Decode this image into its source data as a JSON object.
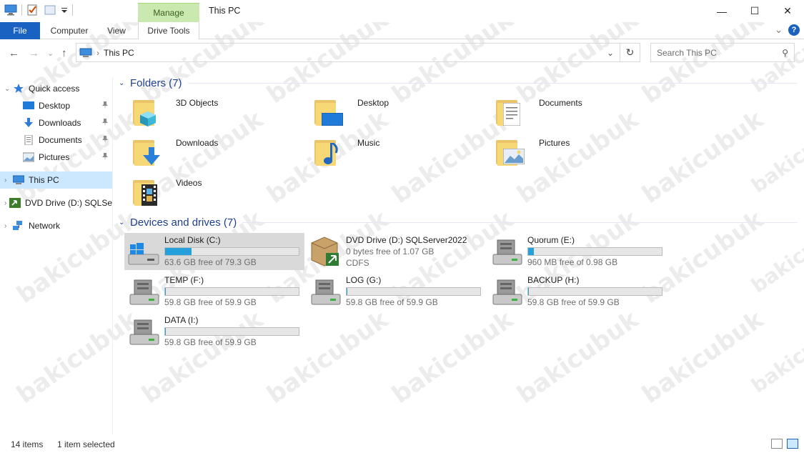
{
  "window": {
    "title": "This PC",
    "manage_tab": "Manage",
    "minimize": "—",
    "maximize": "☐",
    "close": "✕"
  },
  "ribbon": {
    "tabs": [
      "File",
      "Computer",
      "View",
      "Drive Tools"
    ],
    "collapse_glyph": "⌄",
    "help_glyph": "?"
  },
  "nav": {
    "back": "←",
    "forward": "→",
    "recent": "⌄",
    "up": "↑",
    "sep": "›",
    "address": "This PC",
    "dropdown": "⌄",
    "refresh": "↻",
    "search_placeholder": "Search This PC",
    "search_icon": "⚲"
  },
  "sidebar": {
    "items": [
      {
        "label": "Quick access",
        "icon": "star-icon",
        "chevron": "⌄"
      },
      {
        "label": "Desktop",
        "icon": "desktop-icon",
        "pin": "📌"
      },
      {
        "label": "Downloads",
        "icon": "download-icon",
        "pin": "📌"
      },
      {
        "label": "Documents",
        "icon": "document-icon",
        "pin": "📌"
      },
      {
        "label": "Pictures",
        "icon": "pictures-icon",
        "pin": "📌"
      },
      {
        "label": "This PC",
        "icon": "computer-icon",
        "chevron": "›"
      },
      {
        "label": "DVD Drive (D:) SQLSe",
        "icon": "dvd-icon",
        "chevron": "›"
      },
      {
        "label": "Network",
        "icon": "network-icon",
        "chevron": "›"
      }
    ]
  },
  "folders_group": {
    "title": "Folders (7)",
    "chevron": "⌄",
    "items": [
      {
        "name": "3D Objects",
        "icon": "3d-objects-folder-icon"
      },
      {
        "name": "Desktop",
        "icon": "desktop-folder-icon"
      },
      {
        "name": "Documents",
        "icon": "documents-folder-icon"
      },
      {
        "name": "Downloads",
        "icon": "downloads-folder-icon"
      },
      {
        "name": "Music",
        "icon": "music-folder-icon"
      },
      {
        "name": "Pictures",
        "icon": "pictures-folder-icon"
      },
      {
        "name": "Videos",
        "icon": "videos-folder-icon"
      }
    ]
  },
  "drives_group": {
    "title": "Devices and drives (7)",
    "chevron": "⌄",
    "items": [
      {
        "name": "Local Disk (C:)",
        "free": "63.6 GB free of 79.3 GB",
        "used_fraction": 0.198,
        "icon": "windows-disk-icon"
      },
      {
        "name": "DVD Drive (D:) SQLServer2022",
        "free": "0 bytes free of 1.07 GB",
        "fs": "CDFS",
        "icon": "dvd-package-icon"
      },
      {
        "name": "Quorum (E:)",
        "free": "960 MB free of 0.98 GB",
        "used_fraction": 0.045,
        "icon": "hard-disk-icon"
      },
      {
        "name": "TEMP (F:)",
        "free": "59.8 GB free of 59.9 GB",
        "used_fraction": 0.002,
        "icon": "hard-disk-icon"
      },
      {
        "name": "LOG (G:)",
        "free": "59.8 GB free of 59.9 GB",
        "used_fraction": 0.002,
        "icon": "hard-disk-icon"
      },
      {
        "name": "BACKUP (H:)",
        "free": "59.8 GB free of 59.9 GB",
        "used_fraction": 0.002,
        "icon": "hard-disk-icon"
      },
      {
        "name": "DATA (I:)",
        "free": "59.8 GB free of 59.9 GB",
        "used_fraction": 0.002,
        "icon": "hard-disk-icon"
      }
    ]
  },
  "status": {
    "count": "14 items",
    "selected": "1 item selected"
  },
  "watermark": "bakicubuk",
  "colors": {
    "accent": "#1a62c1",
    "selection": "#cce8ff",
    "bar_fill": "#26a0da",
    "group_title": "#1e3f8f",
    "manage_tab": "#c9e9b0"
  }
}
